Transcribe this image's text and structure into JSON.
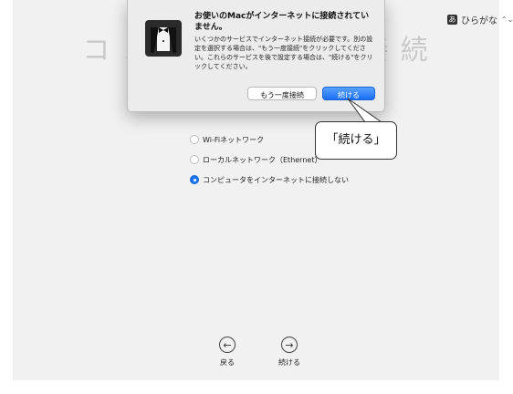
{
  "background_title": "コ ン ピ ュ ー タ を 接 続",
  "ime_indicator": {
    "badge": "あ",
    "label": "ひらがな",
    "chevron": "⌃⌄"
  },
  "dialog": {
    "title": "お使いのMacがインターネットに接続されていません。",
    "body": "いくつかのサービスでインターネット接続が必要です。別の設定を選択する場合は、\"もう一度接続\"をクリックしてください。これらのサービスを後で設定する場合は、\"続ける\"をクリックしてください。",
    "retry_label": "もう一度接続",
    "continue_label": "続ける",
    "icon": "butler-tuxedo-icon"
  },
  "callout": {
    "text": "「続ける」"
  },
  "network_options": [
    {
      "label": "Wi-Fiネットワーク",
      "selected": false
    },
    {
      "label": "ローカルネットワーク（Ethernet）",
      "selected": false
    },
    {
      "label": "コンピュータをインターネットに接続しない",
      "selected": true
    }
  ],
  "nav": {
    "back_label": "戻る",
    "continue_label": "続ける"
  },
  "colors": {
    "accent": "#1c74f5",
    "dialog_bg": "#ececec",
    "screen_bg": "#f1f1f1"
  }
}
